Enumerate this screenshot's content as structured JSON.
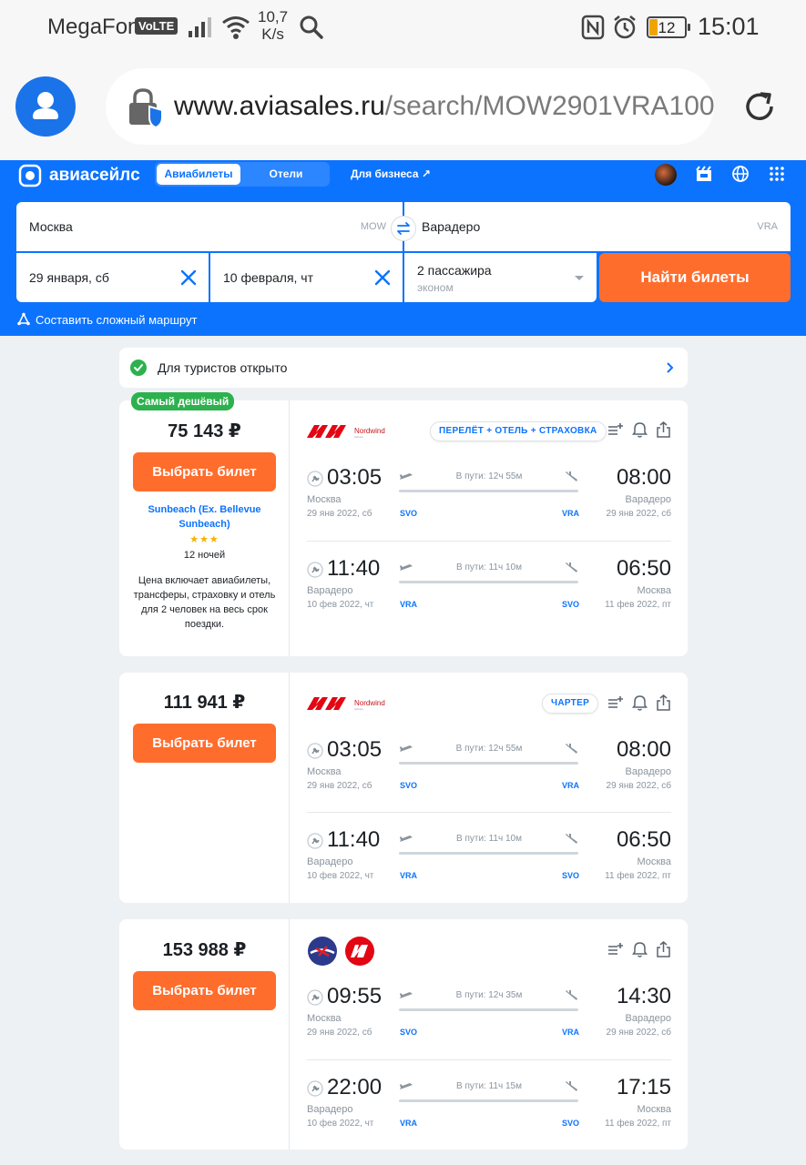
{
  "status_bar": {
    "carrier": "MegaFon",
    "volte": "VoLTE",
    "speed_value": "10,7",
    "speed_unit": "K/s",
    "battery": "12",
    "time": "15:01"
  },
  "browser": {
    "url_host": "www.aviasales.ru",
    "url_path": "/search/MOW2901VRA100"
  },
  "header": {
    "logo": "авиасейлс",
    "tabs": [
      {
        "label": "Авиабилеты",
        "active": true
      },
      {
        "label": "Отели",
        "active": false
      }
    ],
    "business_link": "Для бизнеса ↗",
    "brand_color": "#0c73fe"
  },
  "search": {
    "from": "Москва",
    "from_code": "MOW",
    "to": "Варадеро",
    "to_code": "VRA",
    "depart_date": "29 января, сб",
    "return_date": "10 февраля, чт",
    "passengers": "2 пассажира",
    "cabin": "эконом",
    "find_button": "Найти билеты",
    "complex_route": "Составить сложный маршрут"
  },
  "banner": {
    "text": "Для туристов открыто"
  },
  "results": [
    {
      "badge": "Самый дешёвый",
      "price": "75 143 ₽",
      "select": "Выбрать билет",
      "tag": "ПЕРЕЛЁТ + ОТЕЛЬ + СТРАХОВКА",
      "hotel": "Sunbeach (Ex. Bellevue Sunbeach)",
      "stars": "★★★",
      "nights": "12 ночей",
      "description": "Цена включает авиабилеты, трансферы, страховку и отель для 2 человек на весь срок поездки.",
      "segments": [
        {
          "dep_time": "03:05",
          "arr_time": "08:00",
          "duration": "В пути: 12ч 55м",
          "dep_city": "Москва",
          "arr_city": "Варадеро",
          "dep_date": "29 янв 2022, сб",
          "arr_date": "29 янв 2022, сб",
          "dep_code": "SVO",
          "arr_code": "VRA"
        },
        {
          "dep_time": "11:40",
          "arr_time": "06:50",
          "duration": "В пути: 11ч 10м",
          "dep_city": "Варадеро",
          "arr_city": "Москва",
          "dep_date": "10 фев 2022, чт",
          "arr_date": "11 фев 2022, пт",
          "dep_code": "VRA",
          "arr_code": "SVO"
        }
      ]
    },
    {
      "price": "111 941 ₽",
      "select": "Выбрать билет",
      "tag": "ЧАРТЕР",
      "segments": [
        {
          "dep_time": "03:05",
          "arr_time": "08:00",
          "duration": "В пути: 12ч 55м",
          "dep_city": "Москва",
          "arr_city": "Варадеро",
          "dep_date": "29 янв 2022, сб",
          "arr_date": "29 янв 2022, сб",
          "dep_code": "SVO",
          "arr_code": "VRA"
        },
        {
          "dep_time": "11:40",
          "arr_time": "06:50",
          "duration": "В пути: 11ч 10м",
          "dep_city": "Варадеро",
          "arr_city": "Москва",
          "dep_date": "10 фев 2022, чт",
          "arr_date": "11 фев 2022, пт",
          "dep_code": "VRA",
          "arr_code": "SVO"
        }
      ]
    },
    {
      "price": "153 988 ₽",
      "select": "Выбрать билет",
      "segments": [
        {
          "dep_time": "09:55",
          "arr_time": "14:30",
          "duration": "В пути: 12ч 35м",
          "dep_city": "Москва",
          "arr_city": "Варадеро",
          "dep_date": "29 янв 2022, сб",
          "arr_date": "29 янв 2022, сб",
          "dep_code": "SVO",
          "arr_code": "VRA"
        },
        {
          "dep_time": "22:00",
          "arr_time": "17:15",
          "duration": "В пути: 11ч 15м",
          "dep_city": "Варадеро",
          "arr_city": "Москва",
          "dep_date": "10 фев 2022, чт",
          "arr_date": "11 фев 2022, пт",
          "dep_code": "VRA",
          "arr_code": "SVO"
        }
      ]
    }
  ]
}
